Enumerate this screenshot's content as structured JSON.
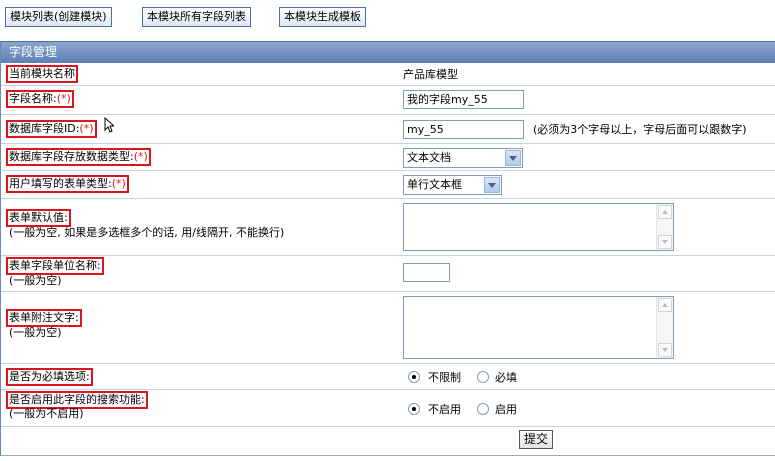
{
  "toolbar": {
    "module_list": "模块列表(创建模块)",
    "field_list": "本模块所有字段列表",
    "generate_template": "本模块生成模板"
  },
  "panel": {
    "title": "字段管理"
  },
  "form": {
    "current_module": {
      "label": "当前模块名称",
      "value": "产品库模型"
    },
    "field_name": {
      "label": "字段名称:",
      "required": "(*)",
      "value": "我的字段my_55"
    },
    "db_field_id": {
      "label": "数据库字段ID:",
      "required": "(*)",
      "value": "my_55",
      "note": "(必须为3个字母以上，字母后面可以跟数字)"
    },
    "db_data_type": {
      "label": "数据库字段存放数据类型:",
      "required": "(*)",
      "selected": "文本文档"
    },
    "form_type": {
      "label": "用户填写的表单类型:",
      "required": "(*)",
      "selected": "单行文本框"
    },
    "default_value": {
      "label": "表单默认值:",
      "hint": "(一般为空, 如果是多选框多个的话, 用/线隔开, 不能换行)",
      "value": ""
    },
    "unit_name": {
      "label": "表单字段单位名称:",
      "hint": "(一般为空)",
      "value": ""
    },
    "note_text": {
      "label": "表单附注文字:",
      "hint": "(一般为空)",
      "value": ""
    },
    "required_field": {
      "label": "是否为必填选项:",
      "options": [
        "不限制",
        "必填"
      ],
      "selected": "不限制"
    },
    "search_enabled": {
      "label": "是否启用此字段的搜索功能:",
      "hint": "(一般为不启用)",
      "options": [
        "不启用",
        "启用"
      ],
      "selected": "不启用"
    },
    "submit_label": "提交"
  },
  "colors": {
    "panel_header": "#5d80b4",
    "highlight_border": "#d9161c",
    "required_mark": "#d9161c"
  }
}
